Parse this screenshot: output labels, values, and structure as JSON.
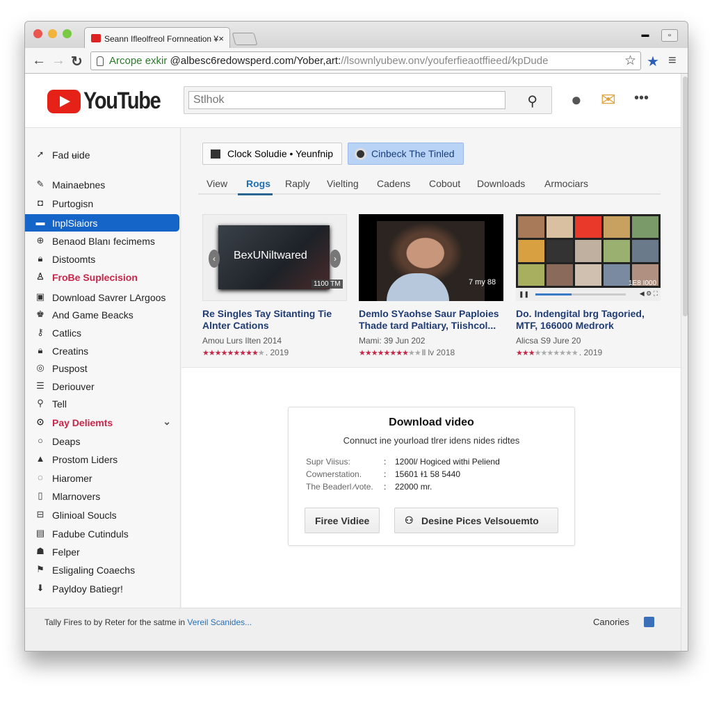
{
  "browser": {
    "tab_title": "Seann Ifleolfreol Fornneation ¥",
    "url_green": "Arcope exkir",
    "url_main": "@albesc6redowsperd.com/Yober,art:",
    "url_light": "//lsownlyubew.onv/youferfieaotffieed/∕kpDude"
  },
  "header": {
    "logo_text": "YouTube",
    "search_placeholder": "Stlhok"
  },
  "sidebar": {
    "items": [
      {
        "label": "Fad ʉide",
        "icon": "arrow-icon"
      },
      {
        "label": "Mainaebnes",
        "icon": "pencil-icon"
      },
      {
        "label": "Purtogisn",
        "icon": "camera-icon"
      },
      {
        "label": "InplSiaiors",
        "icon": "folder-icon",
        "active": true
      },
      {
        "label": "Benaod Blanı fecimems",
        "icon": "globe-icon"
      },
      {
        "label": "Distoomts",
        "icon": "lock-icon"
      },
      {
        "label": "FroBe Suplecision",
        "icon": "user-icon",
        "highlight": true
      },
      {
        "label": "Download Savrer LArgoos",
        "icon": "download-box-icon"
      },
      {
        "label": "And Game Beacks",
        "icon": "game-icon"
      },
      {
        "label": "Catlics",
        "icon": "key-icon"
      },
      {
        "label": "Creatins",
        "icon": "lock-icon"
      },
      {
        "label": "Puspost",
        "icon": "target-icon"
      },
      {
        "label": "Deriouver",
        "icon": "list-icon"
      },
      {
        "label": "Tell",
        "icon": "pin-icon"
      },
      {
        "label": "Pay Deliemts",
        "icon": "check-circle-icon",
        "highlight": true,
        "expandable": true
      },
      {
        "label": "Deaps",
        "icon": "circle-icon"
      },
      {
        "label": "Prostom Liders",
        "icon": "chart-icon"
      },
      {
        "label": "Hiaromer",
        "icon": "cloud-icon"
      },
      {
        "label": "Mlarnovers",
        "icon": "phone-icon"
      },
      {
        "label": "Glinioal Soucls",
        "icon": "briefcase-icon"
      },
      {
        "label": "Fadube Cutinduls",
        "icon": "calendar-icon"
      },
      {
        "label": "Felper",
        "icon": "robot-icon"
      },
      {
        "label": "Esligaling Coaechs",
        "icon": "flag-icon"
      },
      {
        "label": "Payldoy Batiegr!",
        "icon": "download-icon"
      }
    ]
  },
  "main": {
    "button1": "Clock Soludie • Yeunfnip",
    "button2": "Cinbeck The Tinled",
    "tabs": [
      "View",
      "Rogs",
      "Raply",
      "Vielting",
      "Cadens",
      "Cobout",
      "Downloads",
      "Armociars"
    ],
    "active_tab": "Rogs",
    "videos": [
      {
        "overlay": "BexUNiltwared",
        "duration": "1100 TM",
        "title": "Re Singles Tay Sitanting Tie Alnter Cations",
        "meta": "Amou Lurs Ilten  2014",
        "rating": 9,
        "rating_suffix": ". 2019"
      },
      {
        "duration": "7 my 88",
        "title": "Demlo SYaohse Saur Paploies Thade tard Paltiary, Tiishcol...",
        "meta": "Mami:  39    Jun  202",
        "rating": 8,
        "rating_suffix": "ll lv 2018"
      },
      {
        "duration": "1E8 I000",
        "title": "Do. Indengital brg Tagoried, MTF, 166000 Medrork",
        "meta": "Alicsa  S9    Jure  20",
        "rating": 3,
        "rating_suffix": ". 2019"
      }
    ]
  },
  "dialog": {
    "title": "Download video",
    "subtitle": "Connuct ine yourload tlrer idens nides ridtes",
    "rows": [
      {
        "label": "Supr Viisus:",
        "value": "1200l/ Hogiced withi Peliend"
      },
      {
        "label": "Cownerstation.",
        "value": "15601 ɫ1 58 5440"
      },
      {
        "label": "The Beaderl ∕vote.",
        "value": "22000 mr."
      }
    ],
    "button_free": "Firee Vidiee",
    "button_desine": "Desine Pices Velsouemto"
  },
  "footer": {
    "text": "Tally Fires to by Reter for the satme in ",
    "link": "Vereil Scanides...",
    "right": "Canories"
  },
  "colors": {
    "accent": "#1565c9",
    "brand": "#e62117",
    "highlight": "#c8254a"
  }
}
